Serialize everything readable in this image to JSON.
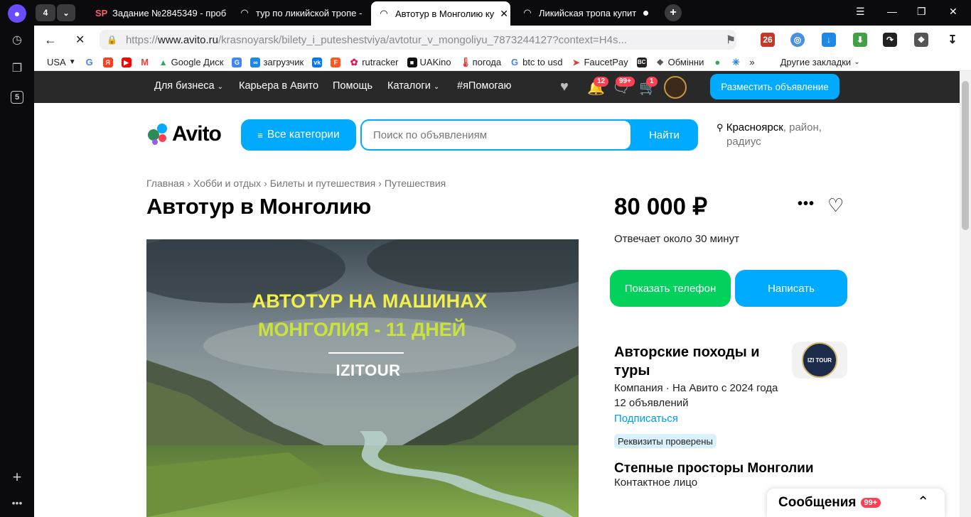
{
  "browser": {
    "workspace_count": "4",
    "sidebar_badge": "5",
    "tabs": [
      {
        "label": "Задание №2845349 - проб",
        "favicon": "SP"
      },
      {
        "label": "тур по ликийской тропе -",
        "favicon": "loading"
      },
      {
        "label": "Автотур в Монголию ку",
        "favicon": "loading",
        "active": true
      },
      {
        "label": "Ликийская тропа купит",
        "favicon": "loading"
      }
    ],
    "url": {
      "prefix": "https://",
      "host": "www.avito.ru",
      "path": "/krasnoyarsk/bilety_i_puteshestviya/avtotur_v_mongoliyu_7873244127?context=H4s..."
    },
    "ext_badge": "26",
    "bookmarks": [
      "USA",
      "",
      "",
      "",
      "",
      "Google Диск",
      "",
      "загрузчик",
      "",
      "",
      "rutracker",
      "UAKino",
      "погода",
      "btc to usd",
      "FaucetPay",
      "",
      "Обмінни",
      "",
      ""
    ],
    "bookmarks_more": "»",
    "other_bookmarks": "Другие закладки"
  },
  "topbar": {
    "links": [
      "Для бизнеса",
      "Карьера в Авито",
      "Помощь",
      "Каталоги",
      "#яПомогаю"
    ],
    "notif_badge": "12",
    "msg_badge": "99+",
    "cart_badge": "1",
    "post_button": "Разместить объявление"
  },
  "header": {
    "logo": "Avito",
    "categories_button": "Все категории",
    "search_placeholder": "Поиск по объявлениям",
    "search_button": "Найти",
    "location_city": "Красноярск",
    "location_rest": ", район,",
    "location_rest2": "радиус"
  },
  "breadcrumbs": [
    "Главная",
    "Хобби и отдых",
    "Билеты и путешествия",
    "Путешествия"
  ],
  "listing": {
    "title": "Автотур в Монголию",
    "photo_line1": "АВТОТУР НА МАШИНАХ",
    "photo_line2": "МОНГОЛИЯ - 11 ДНЕЙ",
    "photo_brand": "IZITOUR",
    "price": "80 000 ₽",
    "reply_time": "Отвечает около 30 минут",
    "phone_button": "Показать телефон",
    "write_button": "Написать"
  },
  "seller": {
    "name": "Авторские походы и туры",
    "logo_text": "IZI TOUR",
    "info": "Компания · На Авито с 2024 года",
    "ads": "12 объявлений",
    "subscribe": "Подписаться",
    "verified": "Реквизиты проверены",
    "contact_name": "Степные просторы Монголии",
    "contact_role": "Контактное лицо"
  },
  "messages": {
    "label": "Сообщения",
    "badge": "99+"
  }
}
